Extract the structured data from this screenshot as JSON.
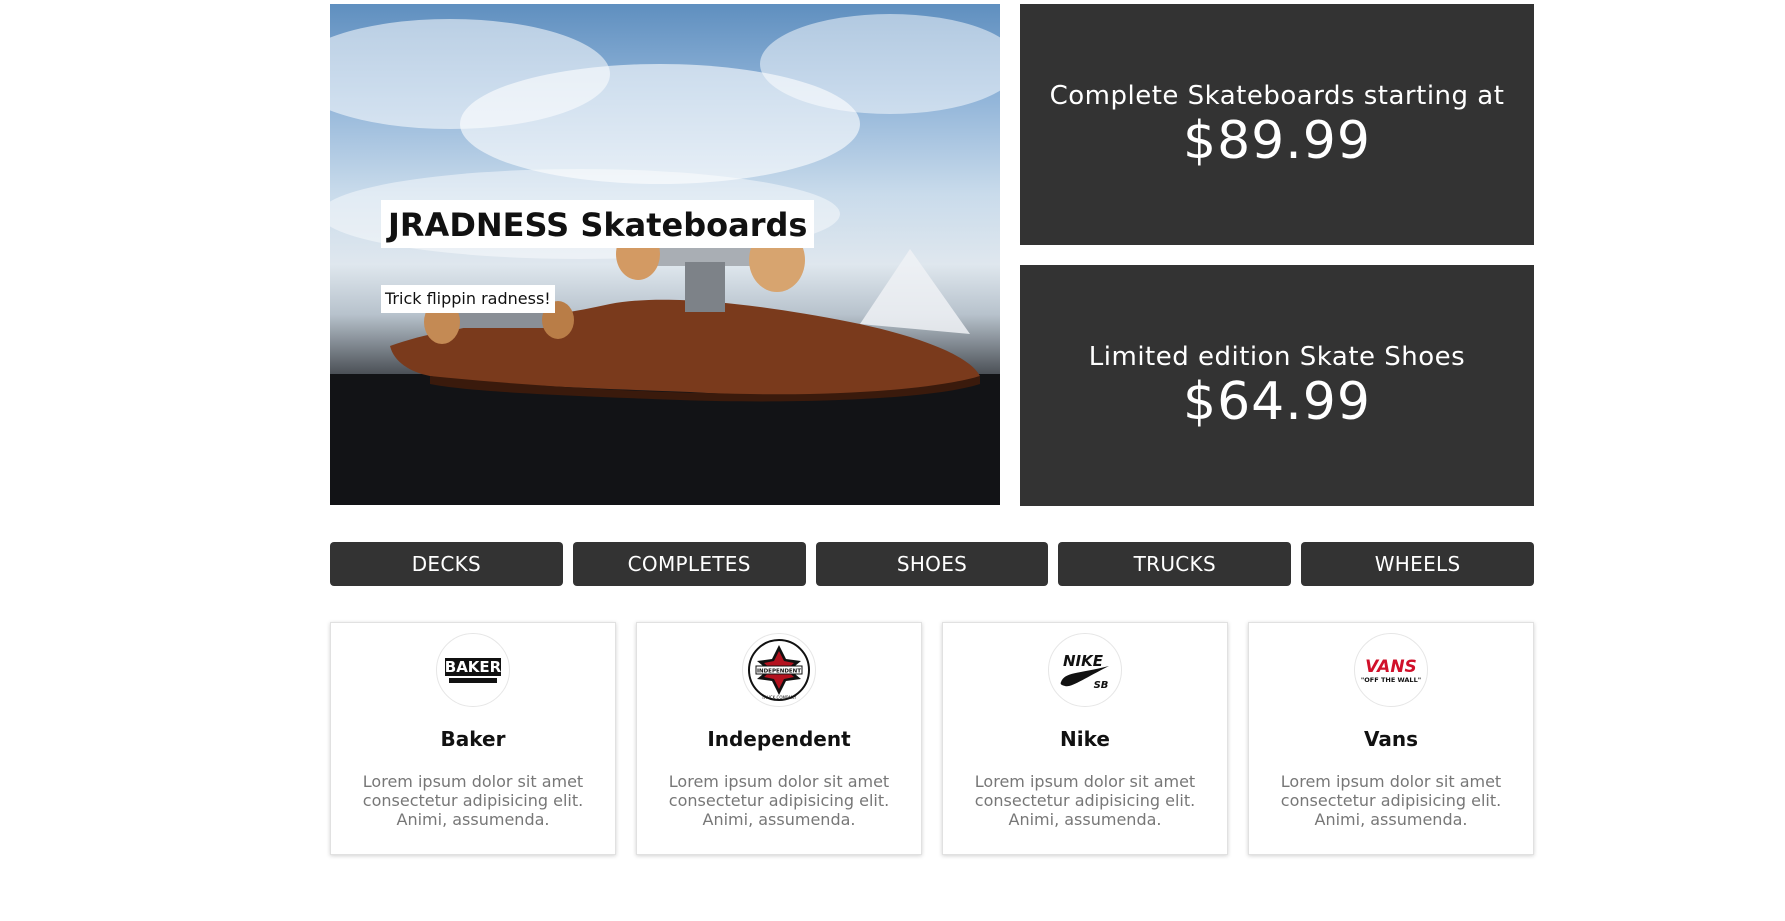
{
  "hero": {
    "title": "JRADNESS Skateboards",
    "subtitle": "Trick flippin radness!"
  },
  "promos": [
    {
      "text": "Complete Skateboards starting at",
      "price": "$89.99"
    },
    {
      "text": "Limited edition Skate Shoes",
      "price": "$64.99"
    }
  ],
  "categories": [
    "DECKS",
    "COMPLETES",
    "SHOES",
    "TRUCKS",
    "WHEELS"
  ],
  "brands": [
    {
      "name": "Baker",
      "logo_text": "BAKER",
      "logo_icon": "baker-logo-icon",
      "desc": "Lorem ipsum dolor sit amet consectetur adipisicing elit. Animi, assumenda."
    },
    {
      "name": "Independent",
      "logo_text": "INDEPENDENT",
      "logo_sub": "TRUCK COMPANY",
      "logo_icon": "independent-cross-icon",
      "desc": "Lorem ipsum dolor sit amet consectetur adipisicing elit. Animi, assumenda."
    },
    {
      "name": "Nike",
      "logo_text": "NIKE",
      "logo_sub": "SB",
      "logo_icon": "nike-swoosh-icon",
      "desc": "Lorem ipsum dolor sit amet consectetur adipisicing elit. Animi, assumenda."
    },
    {
      "name": "Vans",
      "logo_text": "VANS",
      "logo_sub": "\"OFF THE WALL\"",
      "logo_icon": "vans-logo-icon",
      "desc": "Lorem ipsum dolor sit amet consectetur adipisicing elit. Animi, assumenda."
    }
  ],
  "colors": {
    "panel": "#333333",
    "text_light": "#ffffff",
    "desc_text": "#777777",
    "vans_red": "#d1102a"
  }
}
